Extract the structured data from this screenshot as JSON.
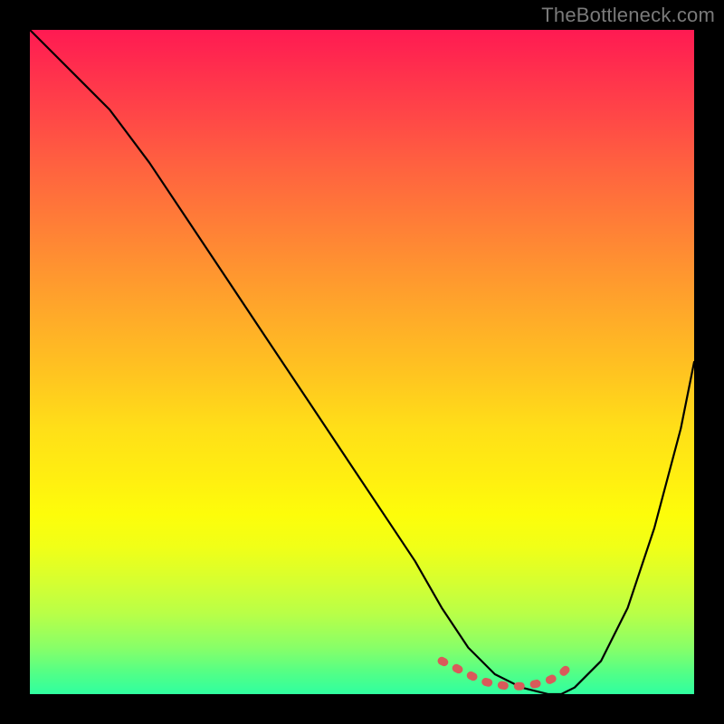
{
  "watermark": "TheBottleneck.com",
  "chart_data": {
    "type": "line",
    "title": "",
    "xlabel": "",
    "ylabel": "",
    "xlim": [
      0,
      100
    ],
    "ylim": [
      0,
      100
    ],
    "gradient_colors": {
      "top": "#ff1a52",
      "mid1": "#ff9430",
      "mid2": "#fff010",
      "bottom": "#30ffa0"
    },
    "series": [
      {
        "name": "curve",
        "color": "#000000",
        "x": [
          0,
          4,
          8,
          12,
          18,
          24,
          30,
          36,
          42,
          48,
          54,
          58,
          62,
          66,
          70,
          74,
          78,
          80,
          82,
          86,
          90,
          94,
          98,
          100
        ],
        "y": [
          100,
          96,
          92,
          88,
          80,
          71,
          62,
          53,
          44,
          35,
          26,
          20,
          13,
          7,
          3,
          1,
          0,
          0,
          1,
          5,
          13,
          25,
          40,
          50
        ]
      },
      {
        "name": "marker-band",
        "color": "#d95a5a",
        "type": "scatter",
        "x": [
          62,
          64,
          66,
          68,
          70,
          72,
          74,
          76,
          78,
          80,
          82
        ],
        "y": [
          5,
          4,
          3,
          2,
          1.5,
          1.2,
          1.2,
          1.5,
          2,
          3,
          5
        ]
      }
    ]
  }
}
